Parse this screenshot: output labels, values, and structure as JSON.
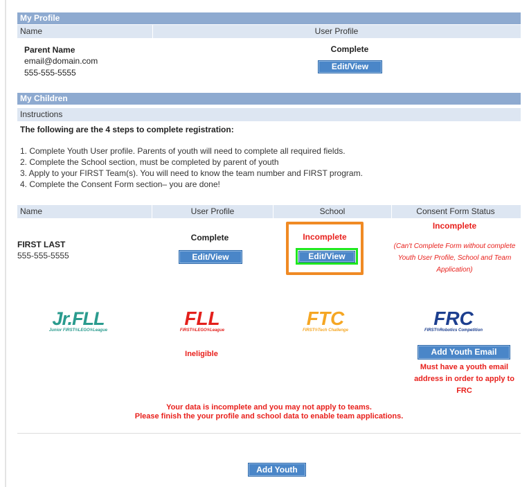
{
  "profile": {
    "section_title": "My Profile",
    "col_name": "Name",
    "col_user_profile": "User Profile",
    "parent_name": "Parent Name",
    "email": "email@domain.com",
    "phone": "555-555-5555",
    "status": "Complete",
    "edit_label": "Edit/View"
  },
  "children": {
    "section_title": "My Children",
    "instructions_label": "Instructions",
    "steps_heading": "The following are the 4 steps to complete registration:",
    "steps": [
      "1. Complete Youth User profile. Parents of youth will need to complete all required fields.",
      "2. Complete the School section, must be completed by parent of youth",
      "3. Apply to your FIRST Team(s). You will need to know the team number and FIRST program.",
      "4. Complete the Consent Form section– you are done!"
    ],
    "col_name": "Name",
    "col_user_profile": "User Profile",
    "col_school": "School",
    "col_consent": "Consent Form Status",
    "child_name": "FIRST LAST",
    "child_phone": "555-555-5555",
    "profile_status": "Complete",
    "profile_edit": "Edit/View",
    "school_status": "Incomplete",
    "school_edit": "Edit/View",
    "consent_status": "Incomplete",
    "consent_note": "(Can't Complete Form without complete Youth User Profile, School and Team Application)"
  },
  "programs": {
    "jrfll": {
      "logo_text": "Jr.FLL",
      "tagline": "Junior FIRST®LEGO®League",
      "color": "#2a9b8e"
    },
    "fll": {
      "logo_text": "FLL",
      "tagline": "FIRST®LEGO®League",
      "color": "#e3201c",
      "status": "Ineligible"
    },
    "ftc": {
      "logo_text": "FTC",
      "tagline": "FIRST®Tech Challenge",
      "color": "#f5a623"
    },
    "frc": {
      "logo_text": "FRC",
      "tagline": "FIRST®Robotics Competition",
      "color": "#1d3f8f",
      "button": "Add Youth Email",
      "note": "Must have a youth email address in order to apply to FRC"
    }
  },
  "warning": {
    "line1": "Your data is incomplete and you may not apply to teams.",
    "line2": "Please finish the your profile and school data to enable team applications."
  },
  "add_youth_label": "Add Youth",
  "colors": {
    "section_header": "#8eaad0",
    "sub_header": "#dde6f2",
    "button": "#4a86c8",
    "alert_red": "#e8201c",
    "highlight_orange": "#f08a24",
    "highlight_green": "#1ee81e"
  }
}
